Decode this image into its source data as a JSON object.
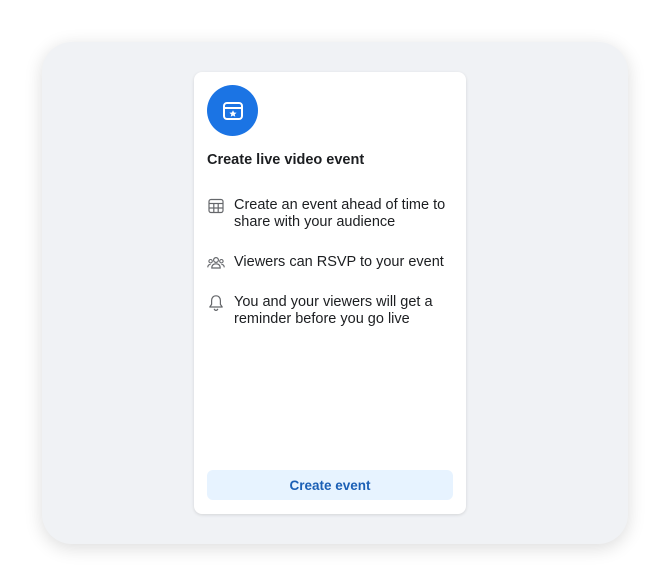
{
  "card": {
    "hero_icon": "calendar-star-icon",
    "title": "Create live video event",
    "features": [
      {
        "icon": "calendar-grid-icon",
        "text": "Create an event ahead of time to share with your audience"
      },
      {
        "icon": "people-icon",
        "text": "Viewers can RSVP to your event"
      },
      {
        "icon": "bell-icon",
        "text": "You and your viewers will get a reminder before you go live"
      }
    ],
    "button_label": "Create event"
  },
  "colors": {
    "accent": "#1b74e4",
    "button_bg": "#e7f3ff",
    "button_text": "#1b5fb5",
    "page_bg": "#f0f2f5"
  }
}
